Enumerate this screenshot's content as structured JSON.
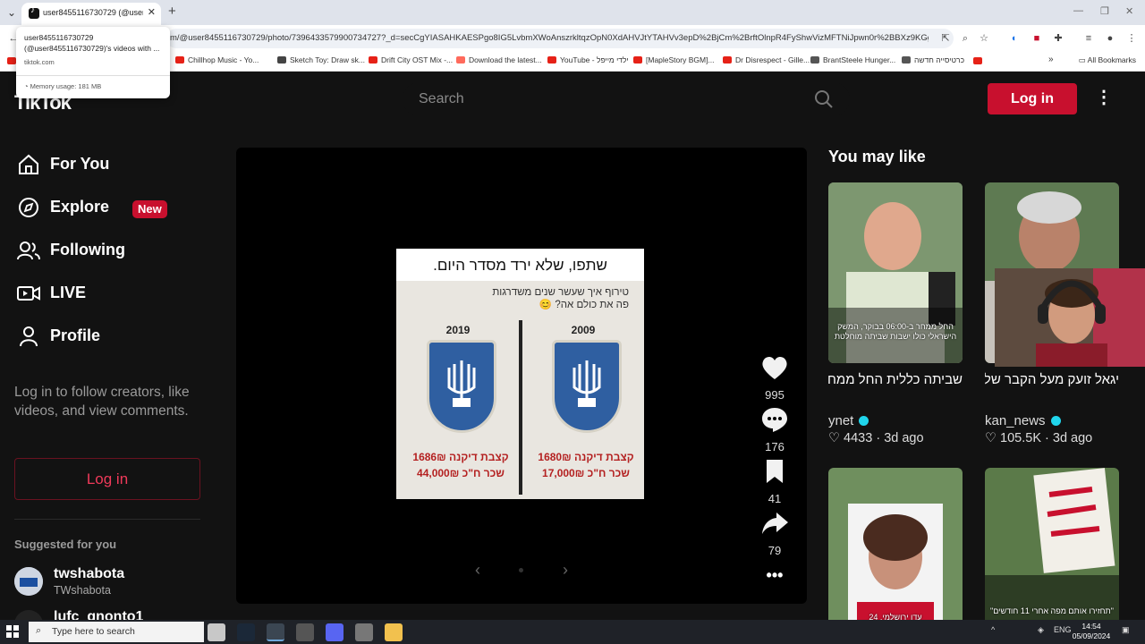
{
  "browser": {
    "tab_title": "user8455116730729 (@user8455116730729)'s videos with ...",
    "url": "m/@user8455116730729/photo/7396433579900734727?_d=secCgYIASAHKAESPgo8IG5LvbmXWoAnszrkltqzOpN0XdAHVJtYTAHVv3epD%2BjCm%2BrftOlnpR4FyShwVizMFTNiJpwn0r%2BBXz9KGgA%3D&_r...",
    "bookmarks": [
      {
        "label": "Chillhop Music - Yo...",
        "color": "#e62117"
      },
      {
        "label": "Sketch Toy: Draw sk...",
        "color": "#444444"
      },
      {
        "label": "Drift City OST Mix -...",
        "color": "#e62117"
      },
      {
        "label": "Download the latest...",
        "color": "#ff6a5c"
      },
      {
        "label": "YouTube - ילדי מייפל",
        "color": "#e62117"
      },
      {
        "label": "[MapleStory BGM]...",
        "color": "#e62117"
      },
      {
        "label": "Dr Disrespect - Gille...",
        "color": "#e62117"
      },
      {
        "label": "BrantSteele Hunger...",
        "color": "#555555"
      },
      {
        "label": "כרטיסייה חדשה",
        "color": "#555555"
      }
    ],
    "all_bookmarks": "All Bookmarks",
    "tooltip": {
      "line1": "user8455116730729",
      "line2": "(@user8455116730729)'s videos with ...",
      "domain": "tiktok.com",
      "memory": "Memory usage: 181 MB"
    }
  },
  "header": {
    "logo": "TikTok",
    "search_placeholder": "Search",
    "login_label": "Log in"
  },
  "sidebar": {
    "nav": [
      {
        "label": "For You"
      },
      {
        "label": "Explore",
        "badge": "New"
      },
      {
        "label": "Following"
      },
      {
        "label": "LIVE"
      },
      {
        "label": "Profile"
      }
    ],
    "login_prompt": "Log in to follow creators, like videos, and view comments.",
    "login_button": "Log in",
    "suggested_title": "Suggested for you",
    "suggested": [
      {
        "name": "twshabota",
        "handle": "TWshabota"
      },
      {
        "name": "lufc_gnonto1",
        "handle": ""
      }
    ]
  },
  "post": {
    "caption": "שתפו, שלא ירד מסדר היום.",
    "note": "טירוף איך שעשר שנים משדרגות פה את כולם אה? 😊",
    "left": {
      "year": "2019",
      "line1": "קצבת דיקנה 1686₪",
      "line2": "שכר ח\"כ 44,000₪"
    },
    "right": {
      "year": "2009",
      "line1": "קצבת דיקנה 1680₪",
      "line2": "שכר ח\"כ 17,000₪"
    },
    "likes": "995",
    "comments": "176",
    "saves": "41",
    "shares": "79"
  },
  "you_may_like": {
    "title": "You may like",
    "items": [
      {
        "title": "שביתה כללית החל ממחר בבוקר | זו הצהרתו של...",
        "overlay": "החל ממחר ב-06:00 בבוקר, המשק הישראלי כולו ישבות שביתה מוחלטת",
        "author": "ynet",
        "likes": "4433",
        "age": "3d ago"
      },
      {
        "title": "יגאל זועק מעל הקבר של בנו אלמוג סרוסי...",
        "author": "kan_news",
        "likes": "105.5K",
        "age": "3d ago"
      },
      {
        "overlay": "עדן ירושלמי, 24"
      },
      {
        "overlay": "\"תחזירו אותם מפה אחרי 11 חודשים\""
      }
    ]
  },
  "taskbar": {
    "search_placeholder": "Type here to search",
    "lang": "ENG",
    "time": "14:54",
    "date": "05/09/2024"
  }
}
